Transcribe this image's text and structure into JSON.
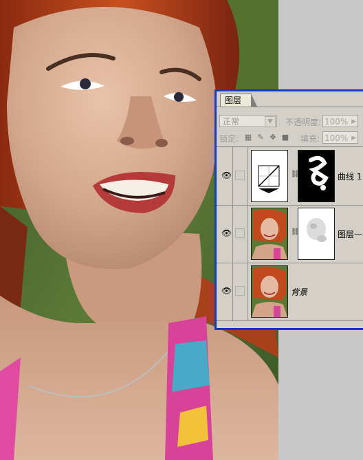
{
  "layers_panel": {
    "tab_label": "图层",
    "blend_mode": "正常",
    "opacity_label": "不透明度:",
    "opacity_value": "100%",
    "lock_label": "锁定:",
    "fill_label": "填充:",
    "fill_value": "100%",
    "layers": [
      {
        "name": "曲线 1",
        "type": "curves-adjustment",
        "visible": true
      },
      {
        "name": "图层一",
        "type": "pixel-with-mask",
        "visible": true
      },
      {
        "name": "背景",
        "type": "background",
        "visible": true
      }
    ]
  },
  "colors": {
    "panel_bg": "#d4d0c8",
    "window_border": "#0a3cc8"
  }
}
